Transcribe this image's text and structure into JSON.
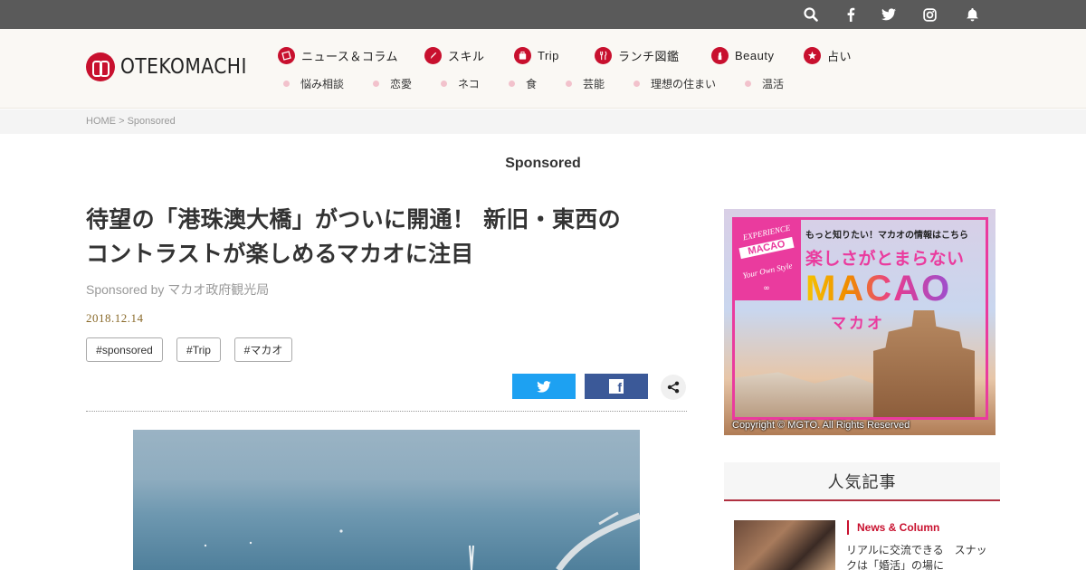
{
  "topbar": {
    "icons": [
      "search-icon",
      "facebook-icon",
      "twitter-icon",
      "instagram-icon",
      "bell-icon"
    ]
  },
  "logo": {
    "text": "OTEKOMACHI"
  },
  "nav": {
    "primary": [
      {
        "label": "ニュース＆コラム",
        "icon": "news-icon"
      },
      {
        "label": "スキル",
        "icon": "pencil-icon"
      },
      {
        "label": "Trip",
        "icon": "suitcase-icon"
      },
      {
        "label": "ランチ図鑑",
        "icon": "fork-icon"
      },
      {
        "label": "Beauty",
        "icon": "lipstick-icon"
      },
      {
        "label": "占い",
        "icon": "star-icon"
      }
    ],
    "secondary": [
      "悩み相談",
      "恋愛",
      "ネコ",
      "食",
      "芸能",
      "理想の住まい",
      "温活"
    ]
  },
  "breadcrumb": {
    "home": "HOME",
    "sep": ">",
    "current": "Sponsored"
  },
  "section_label": "Sponsored",
  "article": {
    "title_line1": "待望の「港珠澳大橋」がついに開通！ 新旧・東西の",
    "title_line2": "コントラストが楽しめるマカオに注目",
    "byline": "Sponsored by マカオ政府観光局",
    "date": "2018.12.14",
    "tags": [
      "#sponsored",
      "#Trip",
      "#マカオ"
    ]
  },
  "share": {
    "fb_glyph": "f"
  },
  "ad": {
    "badge_l1": "EXPERIENCE",
    "badge_l2": "MACAO",
    "badge_l3": "Your Own Style",
    "badge_l4": "∞",
    "note": "もっと知りたい！マカオの情報はこちら",
    "catch": "楽しさがとまらない",
    "big": "MACAO",
    "kana": "マカオ",
    "copyright": "Copyright © MGTO. All Rights Reserved"
  },
  "popular": {
    "heading": "人気記事",
    "items": [
      {
        "category": "News & Column",
        "title": "リアルに交流できる　スナックは「婚活」の場に"
      }
    ]
  }
}
